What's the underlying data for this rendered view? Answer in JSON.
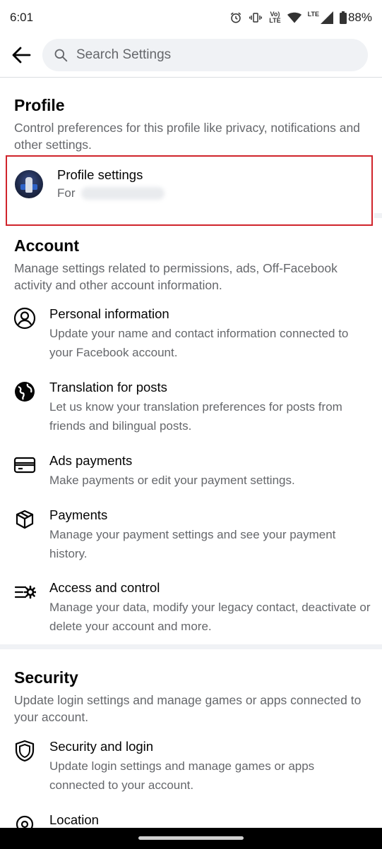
{
  "status_bar": {
    "time": "6:01",
    "battery": "88%",
    "icons": [
      "alarm-icon",
      "vibrate-icon",
      "volte-icon",
      "wifi-icon",
      "lte-signal-icon",
      "battery-icon"
    ],
    "volte_label": "Vo)",
    "volte_sub": "LTE",
    "lte_label": "LTE"
  },
  "header": {
    "search_placeholder": "Search Settings"
  },
  "profile_section": {
    "title": "Profile",
    "description": "Control preferences for this profile like privacy, notifications and other settings.",
    "card": {
      "title": "Profile settings",
      "subtitle_prefix": "For"
    }
  },
  "account_section": {
    "title": "Account",
    "description": "Manage settings related to permissions, ads, Off-Facebook activity and other account information.",
    "items": [
      {
        "icon": "user-circle-icon",
        "title": "Personal information",
        "description": "Update your name and contact information connected to your Facebook account."
      },
      {
        "icon": "globe-icon",
        "title": "Translation for posts",
        "description": "Let us know your translation preferences for posts from friends and bilingual posts."
      },
      {
        "icon": "credit-card-icon",
        "title": "Ads payments",
        "description": "Make payments or edit your payment settings."
      },
      {
        "icon": "package-icon",
        "title": "Payments",
        "description": "Manage your payment settings and see your payment history."
      },
      {
        "icon": "list-gear-icon",
        "title": "Access and control",
        "description": "Manage your data, modify your legacy contact, deactivate or delete your account and more."
      }
    ]
  },
  "security_section": {
    "title": "Security",
    "description": "Update login settings and manage games or apps connected to your account.",
    "items": [
      {
        "icon": "shield-icon",
        "title": "Security and login",
        "description": "Update login settings and manage games or apps connected to your account."
      },
      {
        "icon": "location-icon",
        "title": "Location",
        "description": ""
      }
    ]
  },
  "colors": {
    "accent_highlight": "#d0242b",
    "text_primary": "#050505",
    "text_secondary": "#65676b",
    "search_bg": "#f0f2f5"
  }
}
